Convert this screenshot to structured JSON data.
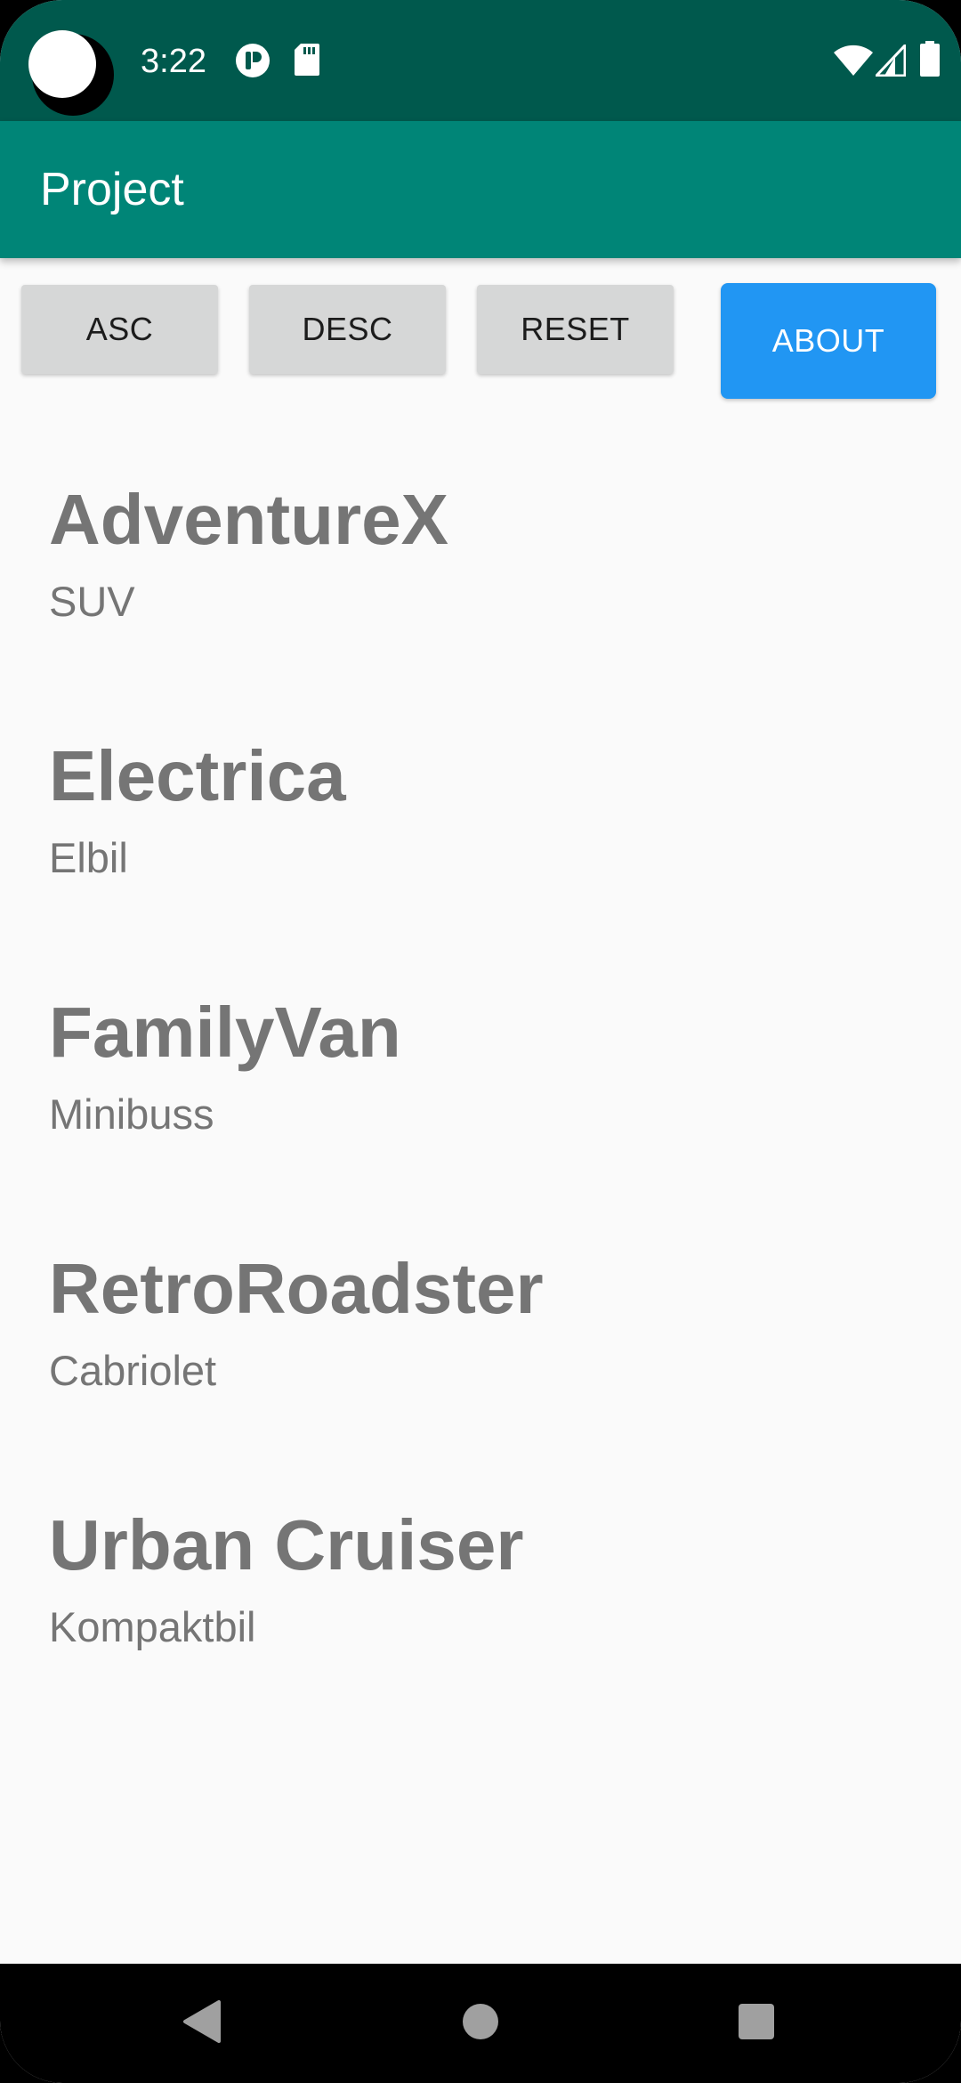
{
  "status_bar": {
    "time": "3:22",
    "icons": [
      "camera-cutout",
      "app-notification-icon",
      "sd-card-icon",
      "wifi-icon",
      "signal-icon",
      "battery-icon"
    ]
  },
  "app_bar": {
    "title": "Project"
  },
  "toolbar": {
    "asc_label": "ASC",
    "desc_label": "DESC",
    "reset_label": "RESET",
    "about_label": "ABOUT"
  },
  "cars": [
    {
      "name": "AdventureX",
      "type": "SUV"
    },
    {
      "name": "Electrica",
      "type": "Elbil"
    },
    {
      "name": "FamilyVan",
      "type": "Minibuss"
    },
    {
      "name": "RetroRoadster",
      "type": "Cabriolet"
    },
    {
      "name": "Urban Cruiser",
      "type": "Kompaktbil"
    }
  ],
  "nav_bar": {
    "icons": [
      "back-icon",
      "home-icon",
      "recents-icon"
    ]
  },
  "colors": {
    "status_bar": "#00594d",
    "app_bar": "#008577",
    "accent": "#2196f3",
    "background": "#fafafa",
    "text_secondary": "#757575"
  }
}
